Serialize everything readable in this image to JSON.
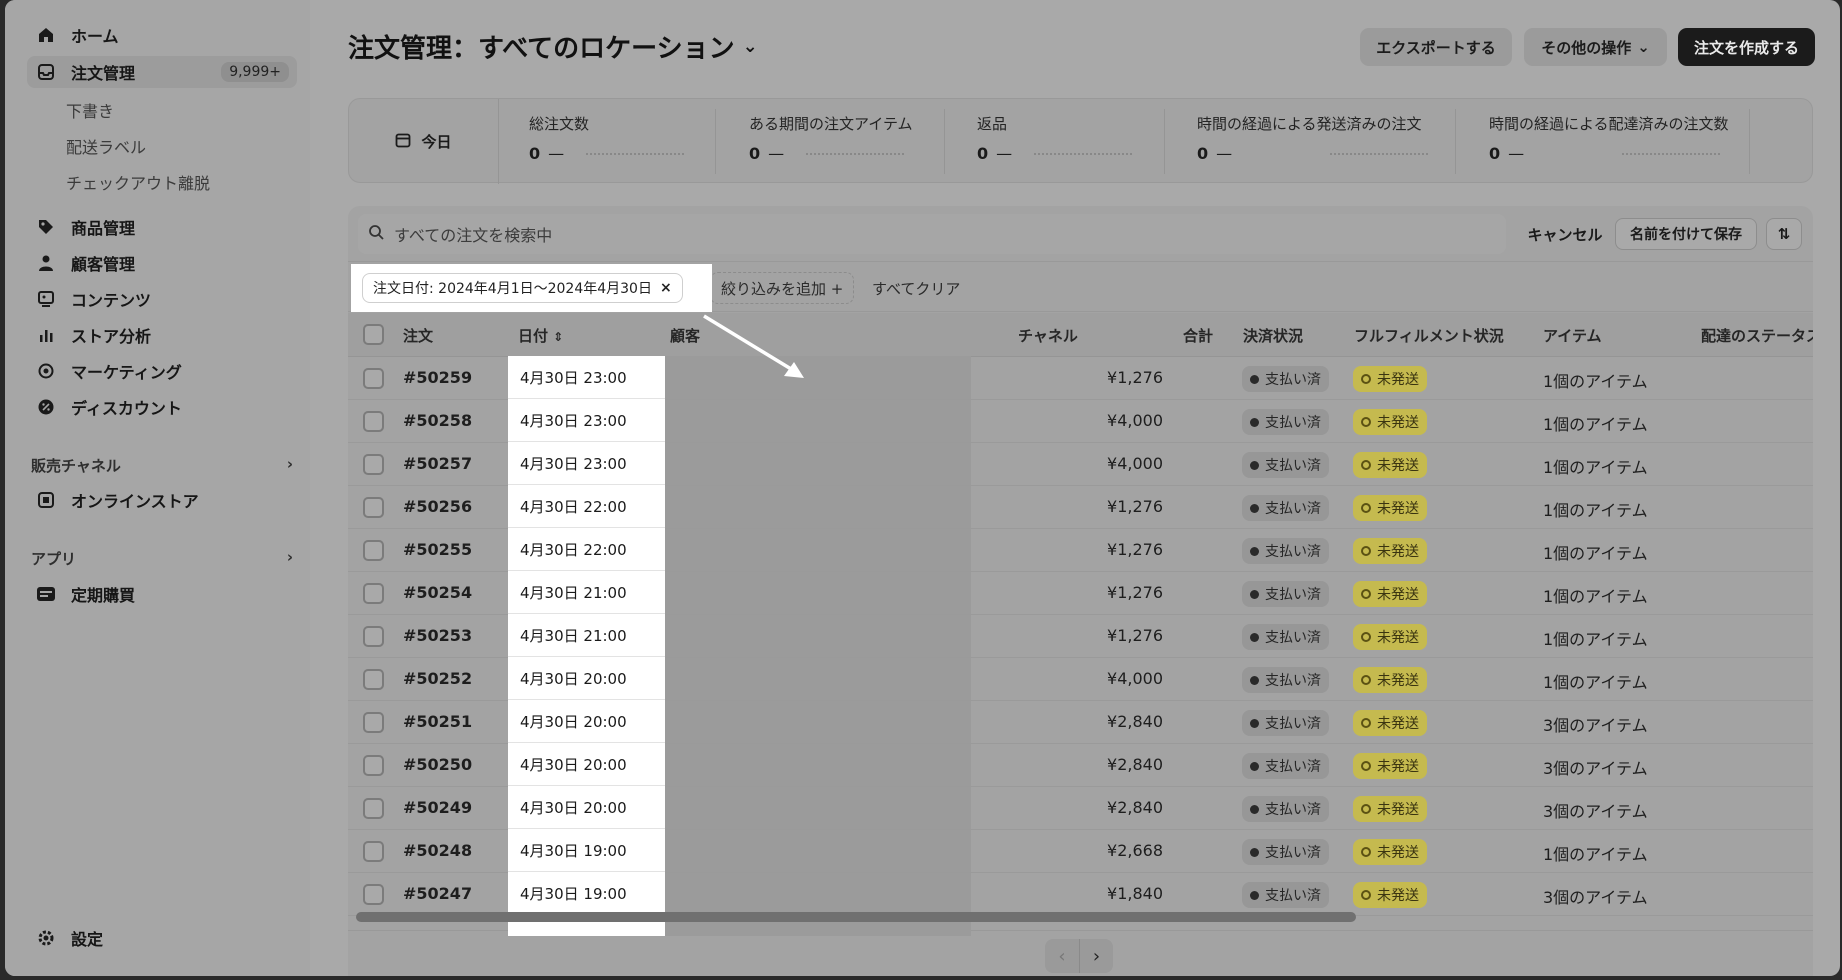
{
  "sidebar": {
    "home": "ホーム",
    "orders": "注文管理",
    "orders_count": "9,999+",
    "sub_items": [
      "下書き",
      "配送ラベル",
      "チェックアウト離脱"
    ],
    "items": [
      "商品管理",
      "顧客管理",
      "コンテンツ",
      "ストア分析",
      "マーケティング",
      "ディスカウント"
    ],
    "sales_channels_heading": "販売チャネル",
    "online_store": "オンラインストア",
    "apps_heading": "アプリ",
    "subscription": "定期購買",
    "settings": "設定"
  },
  "header": {
    "title": "注文管理：すべてのロケーション",
    "export_button": "エクスポートする",
    "more_actions_button": "その他の操作",
    "create_order_button": "注文を作成する"
  },
  "metrics": {
    "today_label": "今日",
    "items": [
      {
        "label": "総注文数",
        "value": "0",
        "dash": "—"
      },
      {
        "label": "ある期間の注文アイテム",
        "value": "0",
        "dash": "—"
      },
      {
        "label": "返品",
        "value": "0",
        "dash": "—"
      },
      {
        "label": "時間の経過による発送済みの注文",
        "value": "0",
        "dash": "—"
      },
      {
        "label": "時間の経過による配達済みの注文数",
        "value": "0",
        "dash": "—"
      }
    ]
  },
  "search": {
    "placeholder": "すべての注文を検索中",
    "cancel": "キャンセル",
    "save_as": "名前を付けて保存"
  },
  "filters": {
    "date_chip": "注文日付: 2024年4月1日〜2024年4月30日",
    "add_filter": "絞り込みを追加 +",
    "clear_all": "すべてクリア"
  },
  "table": {
    "headers": {
      "order": "注文",
      "date": "日付",
      "customer": "顧客",
      "channel": "チャネル",
      "total": "合計",
      "payment": "決済状況",
      "fulfillment": "フルフィルメント状況",
      "items": "アイテム",
      "delivery": "配達のステータス"
    },
    "rows": [
      {
        "id": "#50259",
        "date": "4月30日 23:00",
        "total": "¥1,276",
        "payment": "支払い済",
        "fulfillment": "未発送",
        "items": "1個のアイテム"
      },
      {
        "id": "#50258",
        "date": "4月30日 23:00",
        "total": "¥4,000",
        "payment": "支払い済",
        "fulfillment": "未発送",
        "items": "1個のアイテム"
      },
      {
        "id": "#50257",
        "date": "4月30日 23:00",
        "total": "¥4,000",
        "payment": "支払い済",
        "fulfillment": "未発送",
        "items": "1個のアイテム"
      },
      {
        "id": "#50256",
        "date": "4月30日 22:00",
        "total": "¥1,276",
        "payment": "支払い済",
        "fulfillment": "未発送",
        "items": "1個のアイテム"
      },
      {
        "id": "#50255",
        "date": "4月30日 22:00",
        "total": "¥1,276",
        "payment": "支払い済",
        "fulfillment": "未発送",
        "items": "1個のアイテム"
      },
      {
        "id": "#50254",
        "date": "4月30日 21:00",
        "total": "¥1,276",
        "payment": "支払い済",
        "fulfillment": "未発送",
        "items": "1個のアイテム"
      },
      {
        "id": "#50253",
        "date": "4月30日 21:00",
        "total": "¥1,276",
        "payment": "支払い済",
        "fulfillment": "未発送",
        "items": "1個のアイテム"
      },
      {
        "id": "#50252",
        "date": "4月30日 20:00",
        "total": "¥4,000",
        "payment": "支払い済",
        "fulfillment": "未発送",
        "items": "1個のアイテム"
      },
      {
        "id": "#50251",
        "date": "4月30日 20:00",
        "total": "¥2,840",
        "payment": "支払い済",
        "fulfillment": "未発送",
        "items": "3個のアイテム"
      },
      {
        "id": "#50250",
        "date": "4月30日 20:00",
        "total": "¥2,840",
        "payment": "支払い済",
        "fulfillment": "未発送",
        "items": "3個のアイテム"
      },
      {
        "id": "#50249",
        "date": "4月30日 20:00",
        "total": "¥2,840",
        "payment": "支払い済",
        "fulfillment": "未発送",
        "items": "3個のアイテム"
      },
      {
        "id": "#50248",
        "date": "4月30日 19:00",
        "total": "¥2,668",
        "payment": "支払い済",
        "fulfillment": "未発送",
        "items": "1個のアイテム"
      },
      {
        "id": "#50247",
        "date": "4月30日 19:00",
        "total": "¥1,840",
        "payment": "支払い済",
        "fulfillment": "未発送",
        "items": "3個のアイテム"
      }
    ]
  },
  "colors": {
    "fulfillment_badge": "#c5ba4f",
    "highlight": "#ffffff",
    "primary_button": "#1b1b1b"
  }
}
